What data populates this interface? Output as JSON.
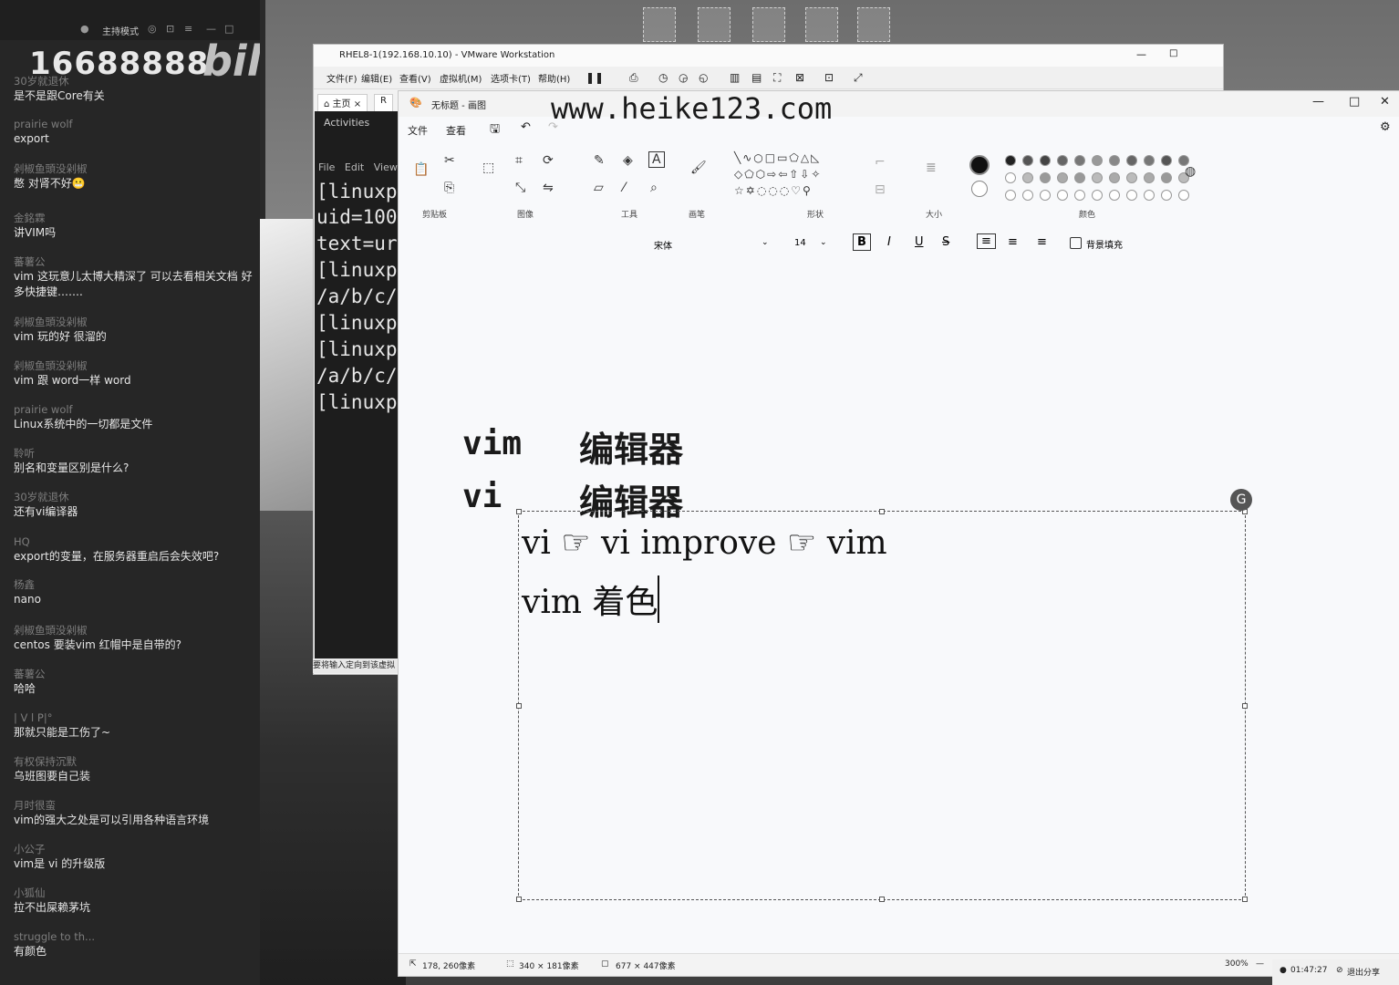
{
  "chat": {
    "mode": "主持模式",
    "viewer_count": "16688888",
    "logo": "bilibili",
    "messages": [
      {
        "user": "30岁就退休",
        "text": "是不是跟Core有关"
      },
      {
        "user": "prairie wolf",
        "text": "export"
      },
      {
        "user": "剁椒鱼頭没剁椒",
        "text": "憋 对肾不好😬"
      },
      {
        "user": "金銘霖",
        "text": "讲VIM吗"
      },
      {
        "user": "蕃薯公",
        "text": "vim 这玩意儿太博大精深了  可以去看相关文档 好多快捷键……."
      },
      {
        "user": "剁椒鱼頭没剁椒",
        "text": "vim 玩的好 很溜的"
      },
      {
        "user": "剁椒鱼頭没剁椒",
        "text": "vim 跟 word一样  word"
      },
      {
        "user": "prairie wolf",
        "text": "Linux系统中的一切都是文件"
      },
      {
        "user": "聆听",
        "text": "别名和变量区别是什么?"
      },
      {
        "user": "30岁就退休",
        "text": "还有vi编译器"
      },
      {
        "user": "HQ",
        "text": "export的变量，在服务器重启后会失效吧?"
      },
      {
        "user": "杨鑫",
        "text": "nano"
      },
      {
        "user": "剁椒鱼頭没剁椒",
        "text": "centos  要装vim   红帽中是自带的?"
      },
      {
        "user": "蕃薯公",
        "text": "哈哈"
      },
      {
        "user": "|      V      l      P|°",
        "text": "那就只能是工伤了~"
      },
      {
        "user": "有权保持沉默",
        "text": "乌班图要自己装"
      },
      {
        "user": "月时很蛮",
        "text": "vim的强大之处是可以引用各种语言环境"
      },
      {
        "user": "小公子",
        "text": "vim是 vi 的升级版"
      },
      {
        "user": "小狐仙",
        "text": "拉不出屎赖茅坑"
      },
      {
        "user": "struggle to th...",
        "text": "有颜色"
      }
    ]
  },
  "vmware": {
    "title": "RHEL8-1(192.168.10.10) - VMware Workstation",
    "menu": [
      "文件(F)",
      "编辑(E)",
      "查看(V)",
      "虚拟机(M)",
      "选项卡(T)",
      "帮助(H)"
    ],
    "tab_home": "主页",
    "tab_vm": "R",
    "activities": "Activities",
    "term_menu": [
      "File",
      "Edit",
      "View"
    ],
    "term_lines": [
      "[linuxp",
      "uid=100",
      "text=ur",
      "[linuxp",
      "/a/b/c/",
      "[linuxp",
      "[linuxp",
      "/a/b/c/",
      "[linuxp"
    ],
    "status": "要将输入定向到该虚拟"
  },
  "watermark": "www.heike123.com",
  "paint": {
    "title": "无标题 - 画图",
    "menu": [
      "文件",
      "查看"
    ],
    "groups": [
      "剪贴板",
      "图像",
      "工具",
      "画笔",
      "形状",
      "大小",
      "颜色"
    ],
    "font": "宋体",
    "font_size": "14",
    "bg_fill": "背景填充",
    "canvas_lines": [
      {
        "a": "vim",
        "b": "编辑器"
      },
      {
        "a": "vi",
        "b": "编辑器"
      }
    ],
    "selection_lines": [
      "vi  ☞  vi  improve  ☞  vim",
      "vim 着色"
    ],
    "status": {
      "pos": "178, 260像素",
      "sel": "340 × 181像素",
      "size": "677 × 447像素",
      "zoom": "300%"
    }
  },
  "tray": {
    "time": "01:47:27",
    "exit": "退出分享"
  }
}
